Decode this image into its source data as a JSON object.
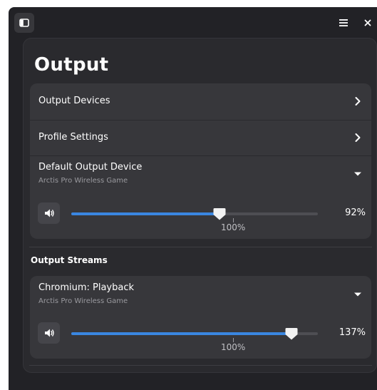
{
  "titlebar": {
    "sidebar_icon": "sidebar-toggle-icon",
    "menu_icon": "hamburger-menu-icon",
    "close_icon": "close-icon"
  },
  "page": {
    "title": "Output"
  },
  "device_card": {
    "output_devices_label": "Output Devices",
    "profile_settings_label": "Profile Settings",
    "default_device": {
      "label": "Default Output Device",
      "subtitle": "Arctis Pro Wireless Game",
      "volume_percent": 92,
      "volume_text": "92%",
      "mark_label": "100%",
      "slider_fraction": 0.6
    }
  },
  "streams": {
    "section_title": "Output Streams",
    "items": [
      {
        "label": "Chromium: Playback",
        "subtitle": "Arctis Pro Wireless Game",
        "volume_percent": 137,
        "volume_text": "137%",
        "mark_label": "100%",
        "slider_fraction": 0.892
      }
    ]
  },
  "colors": {
    "accent": "#3a86e0",
    "window_bg": "#222226",
    "card_bg": "#37373b",
    "subtitle": "#9a9a9f"
  }
}
